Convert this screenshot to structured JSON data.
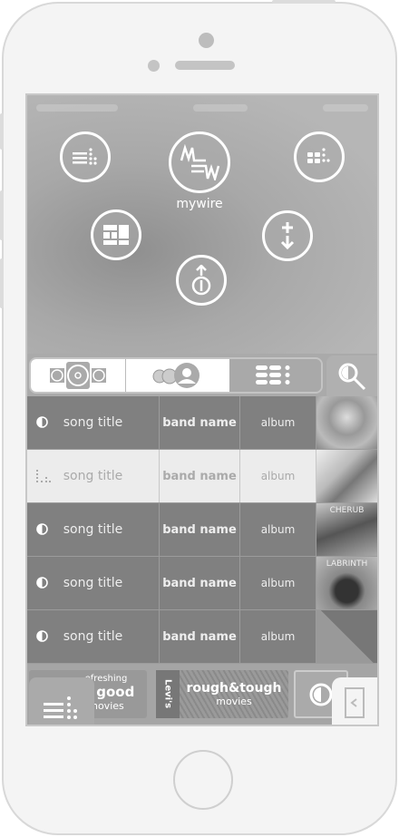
{
  "app": {
    "logo_label": "mywire"
  },
  "hero_buttons": [
    {
      "name": "playlist",
      "icon": "playlist-icon"
    },
    {
      "name": "mywire",
      "icon": "mywire-logo-icon"
    },
    {
      "name": "grid-menu",
      "icon": "grid-dots-icon"
    },
    {
      "name": "tiles",
      "icon": "tiles-icon"
    },
    {
      "name": "add-download",
      "icon": "add-download-icon"
    },
    {
      "name": "upload",
      "icon": "upload-icon"
    }
  ],
  "tabs": [
    {
      "name": "speakers",
      "icon": "speakers-icon",
      "active": true
    },
    {
      "name": "users",
      "icon": "users-icon",
      "active": true
    },
    {
      "name": "list",
      "icon": "list-icon",
      "active": false
    }
  ],
  "search": {
    "icon": "search-icon"
  },
  "tracks": [
    {
      "title": "song title",
      "band": "band name",
      "album": "album",
      "icon": "half-circle-icon",
      "selected": false
    },
    {
      "title": "song title",
      "band": "band name",
      "album": "album",
      "icon": "equalizer-icon",
      "selected": true
    },
    {
      "title": "song title",
      "band": "band name",
      "album": "album",
      "icon": "half-circle-icon",
      "selected": false
    },
    {
      "title": "song title",
      "band": "band name",
      "album": "album",
      "icon": "half-circle-icon",
      "selected": false
    },
    {
      "title": "song title",
      "band": "band name",
      "album": "album",
      "icon": "half-circle-icon",
      "selected": false
    }
  ],
  "album_art_text": [
    "CHERUB",
    "LABRINTH"
  ],
  "banners": [
    {
      "line1": "efreshing",
      "line2": "el good",
      "line3": "movies"
    },
    {
      "brand": "Levi's",
      "line1": "rough&tough",
      "line2": "movies"
    }
  ],
  "colors": {
    "row_bg": "#808080",
    "selected_row_bg": "#ececec",
    "accent": "#ffffff"
  }
}
